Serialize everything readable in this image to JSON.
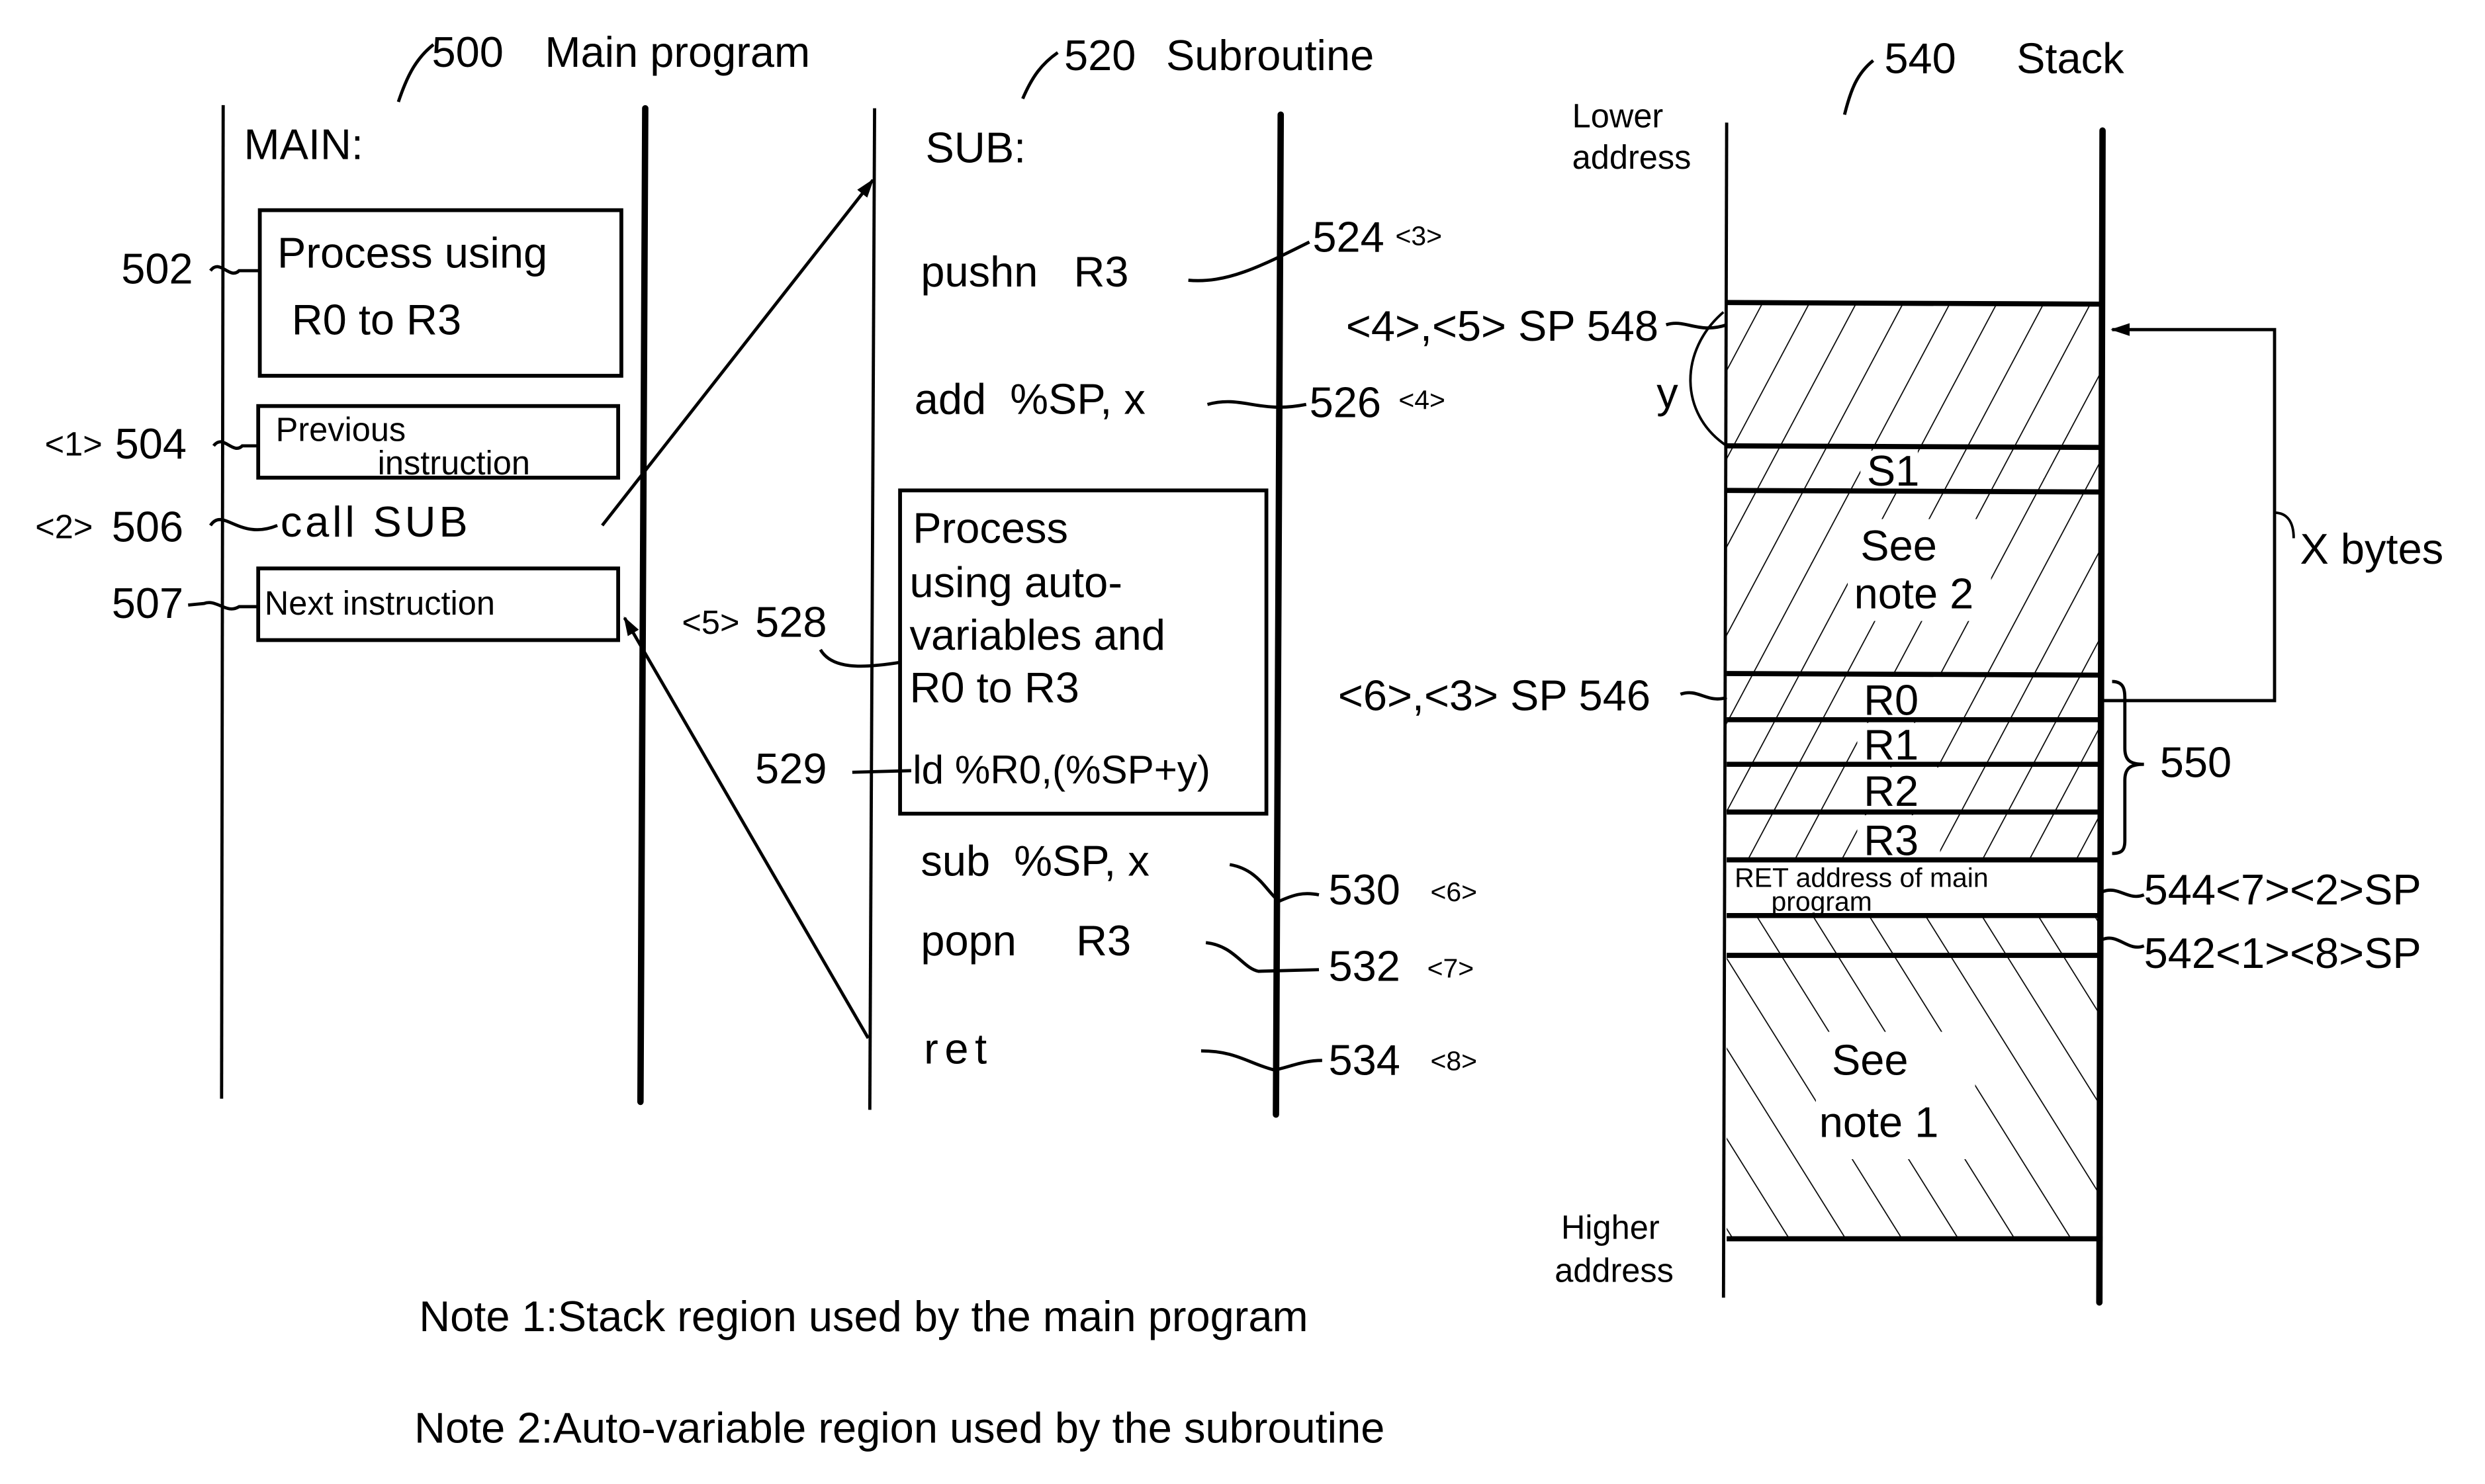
{
  "main_program": {
    "ref": "500",
    "title": "Main program",
    "label": "MAIN:",
    "items": [
      {
        "ref": "502",
        "step": "",
        "lines": [
          "Process using",
          "R0 to R3"
        ],
        "boxed": true
      },
      {
        "ref": "504",
        "step": "<1>",
        "lines": [
          "Previous",
          "instruction"
        ],
        "boxed": true
      },
      {
        "ref": "506",
        "step": "<2>",
        "lines": [
          "call  SUB"
        ],
        "boxed": false
      },
      {
        "ref": "507",
        "step": "",
        "lines": [
          "Next  instruction"
        ],
        "boxed": true
      }
    ]
  },
  "subroutine": {
    "ref": "520",
    "title": "Subroutine",
    "label": "SUB:",
    "instructions": [
      {
        "ref": "524",
        "step": "<3>",
        "text": "pushn   R3"
      },
      {
        "ref": "526",
        "step": "<4>",
        "text": "add  %SP, x"
      },
      {
        "ref": "528",
        "step": "<5>",
        "lines": [
          "Process",
          "using  auto-",
          "variables and",
          "R0 to R3"
        ]
      },
      {
        "ref": "529",
        "step": "",
        "text": "ld %R0,(%SP+y)"
      },
      {
        "ref": "530",
        "step": "<6>",
        "text": "sub  %SP, x"
      },
      {
        "ref": "532",
        "step": "<7>",
        "text": "popn     R3"
      },
      {
        "ref": "534",
        "step": "<8>",
        "text": "ret"
      }
    ]
  },
  "stack": {
    "ref": "540",
    "title": "Stack",
    "lower_address": [
      "Lower",
      "address"
    ],
    "higher_address": [
      "Higher",
      "address"
    ],
    "cells": [
      {
        "label": "",
        "hatch": "forward"
      },
      {
        "label": "S1",
        "hatch": "forward"
      },
      {
        "label": "See note 2",
        "lines": [
          "See",
          "note 2"
        ],
        "hatch": "forward"
      },
      {
        "label": "R0",
        "hatch": "forward"
      },
      {
        "label": "R1",
        "hatch": "forward"
      },
      {
        "label": "R2",
        "hatch": "forward"
      },
      {
        "label": "R3",
        "hatch": "forward"
      },
      {
        "label": "RET address of main program",
        "lines": [
          "RET address of main",
          "program"
        ],
        "hatch": "none"
      },
      {
        "label": "",
        "hatch": "backward"
      },
      {
        "label": "See note 1",
        "lines": [
          "See",
          "note 1"
        ],
        "hatch": "backward"
      }
    ],
    "pointers": [
      {
        "ref": "548",
        "text": "<4>,<5> SP 548",
        "side": "left"
      },
      {
        "ref": "546",
        "text": "<6>,<3> SP 546",
        "side": "left"
      },
      {
        "ref": "544",
        "text": "544<7><2>SP",
        "side": "right"
      },
      {
        "ref": "542",
        "text": "542<1><8>SP",
        "side": "right"
      }
    ],
    "y_label": "y",
    "x_bytes_label": "X bytes",
    "register_group_ref": "550"
  },
  "notes": [
    "Note 1:Stack region used by the main program",
    "Note 2:Auto-variable region used by the subroutine"
  ]
}
